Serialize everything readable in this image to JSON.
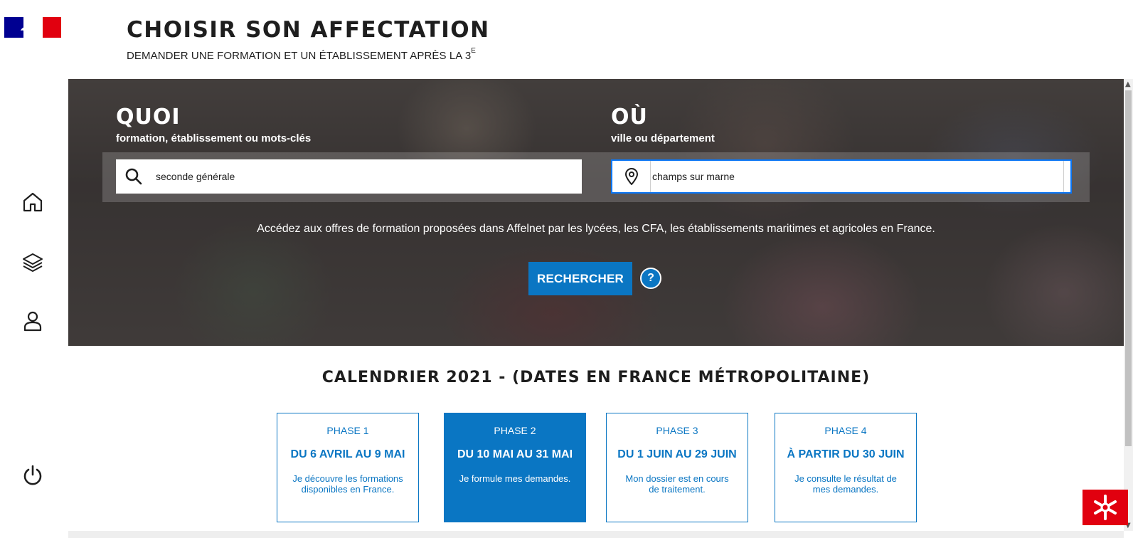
{
  "header": {
    "title": "CHOISIR SON AFFECTATION",
    "subtitle": "DEMANDER UNE FORMATION ET UN ÉTABLISSEMENT APRÈS LA 3",
    "subtitle_sup": "E"
  },
  "logo": {
    "icon": "marianne-logo-icon",
    "colors": {
      "blue": "#000091",
      "red": "#e1000f"
    }
  },
  "sidenav": [
    {
      "icon": "home-icon"
    },
    {
      "icon": "layers-icon"
    },
    {
      "icon": "user-icon"
    },
    {
      "icon": "power-icon"
    }
  ],
  "search": {
    "what_title": "QUOI",
    "what_subtitle": "formation, établissement ou mots-clés",
    "what_value": "seconde générale",
    "where_title": "OÙ",
    "where_subtitle": "ville ou département",
    "where_value": "champs sur marne",
    "description": "Accédez aux offres de formation proposées dans Affelnet par les lycées, les CFA, les établissements maritimes et agricoles en France.",
    "search_button": "RECHERCHER",
    "help_button": "?"
  },
  "calendar": {
    "title": "CALENDRIER 2021 - (DATES EN FRANCE MÉTROPOLITAINE)",
    "phases": [
      {
        "label": "PHASE 1",
        "dates": "DU 6 AVRIL AU 9 MAI",
        "desc": "Je découvre les formations disponibles en France.",
        "active": false
      },
      {
        "label": "PHASE 2",
        "dates": "DU 10 MAI AU 31 MAI",
        "desc": "Je formule mes demandes.",
        "active": true
      },
      {
        "label": "PHASE 3",
        "dates": "DU 1 JUIN AU 29 JUIN",
        "desc": "Mon dossier est en cours de traitement.",
        "active": false
      },
      {
        "label": "PHASE 4",
        "dates": "À PARTIR DU 30 JUIN",
        "desc": "Je consulte le résultat de mes demandes.",
        "active": false
      }
    ]
  },
  "help_widget": {
    "icon": "help-asterisk-icon"
  },
  "colors": {
    "accent": "#0a76c3",
    "focus_border": "#0a76f6",
    "widget_red": "#e1000f"
  }
}
